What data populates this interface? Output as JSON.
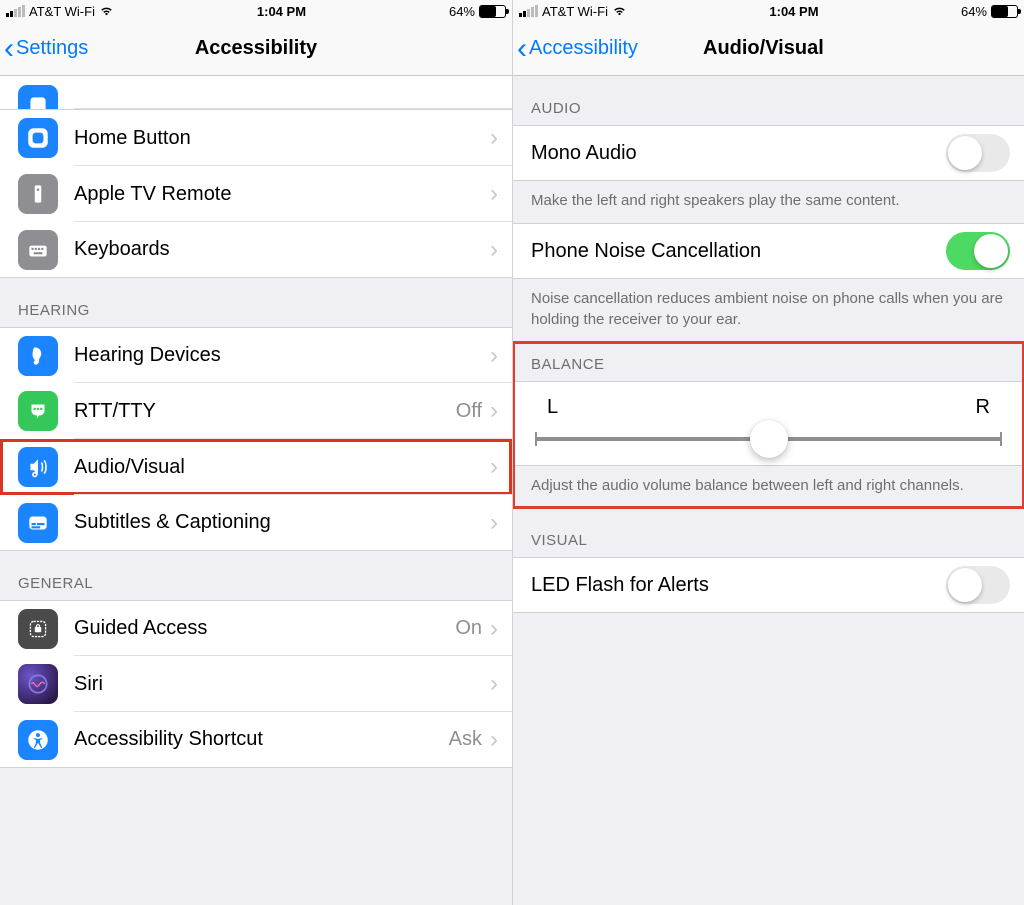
{
  "status": {
    "carrier": "AT&T Wi-Fi",
    "time": "1:04 PM",
    "battery_percent": "64%",
    "battery_fill_pct": 64
  },
  "left": {
    "back_label": "Settings",
    "title": "Accessibility",
    "sections": {
      "hearing_header": "HEARING",
      "general_header": "GENERAL"
    },
    "rows": {
      "home_button": "Home Button",
      "apple_tv": "Apple TV Remote",
      "keyboards": "Keyboards",
      "hearing_devices": "Hearing Devices",
      "rtt_tty": "RTT/TTY",
      "rtt_tty_value": "Off",
      "audio_visual": "Audio/Visual",
      "subtitles": "Subtitles & Captioning",
      "guided_access": "Guided Access",
      "guided_access_value": "On",
      "siri": "Siri",
      "accessibility_shortcut": "Accessibility Shortcut",
      "accessibility_shortcut_value": "Ask"
    }
  },
  "right": {
    "back_label": "Accessibility",
    "title": "Audio/Visual",
    "sections": {
      "audio_header": "AUDIO",
      "balance_header": "BALANCE",
      "visual_header": "VISUAL"
    },
    "rows": {
      "mono_audio": "Mono Audio",
      "mono_audio_footer": "Make the left and right speakers play the same content.",
      "phone_noise": "Phone Noise Cancellation",
      "phone_noise_footer": "Noise cancellation reduces ambient noise on phone calls when you are holding the receiver to your ear.",
      "balance_L": "L",
      "balance_R": "R",
      "balance_footer": "Adjust the audio volume balance between left and right channels.",
      "led_flash": "LED Flash for Alerts"
    },
    "toggles": {
      "mono_audio": false,
      "phone_noise": true,
      "led_flash": false
    }
  },
  "colors": {
    "ios_blue": "#007aff",
    "icon_blue": "#1b84ff",
    "icon_gray": "#8e8e93",
    "icon_green": "#34c759",
    "icon_deep_blue": "#2168ff",
    "siri_gradient": "#3a2e66",
    "highlight_red": "#d93526"
  }
}
